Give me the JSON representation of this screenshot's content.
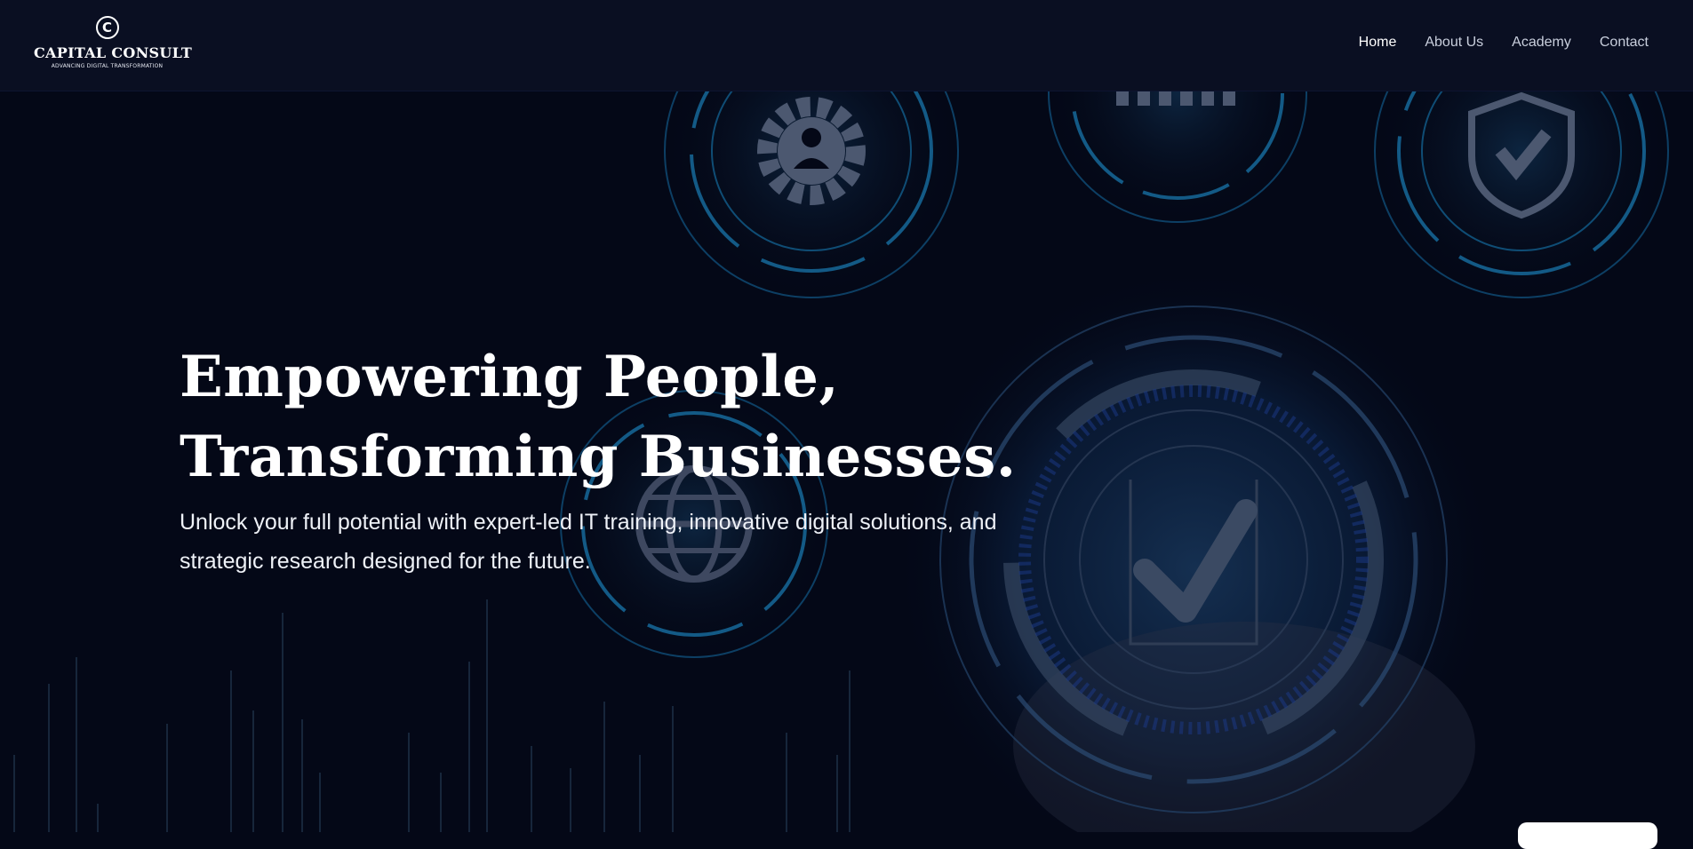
{
  "brand": {
    "logo_letter": "C",
    "name": "CAPITAL CONSULT",
    "tagline": "ADVANCING DIGITAL TRANSFORMATION"
  },
  "nav": {
    "items": [
      {
        "label": "Home",
        "active": true
      },
      {
        "label": "About Us",
        "active": false
      },
      {
        "label": "Academy",
        "active": false
      },
      {
        "label": "Contact",
        "active": false
      }
    ]
  },
  "hero": {
    "headline_line1": "Empowering People,",
    "headline_line2": "Transforming Businesses.",
    "subtext": "Unlock your full potential with expert-led IT training, innovative digital solutions, and strategic research designed for the future.",
    "background_icons": [
      "gear-person-icon",
      "network-icon",
      "shield-check-icon",
      "globe-icon",
      "checkmark-icon"
    ]
  },
  "colors": {
    "page_bg": "#040817",
    "nav_bg": "#0a0f22",
    "hud_blue": "#1f6fa8",
    "text_white": "#ffffff"
  }
}
